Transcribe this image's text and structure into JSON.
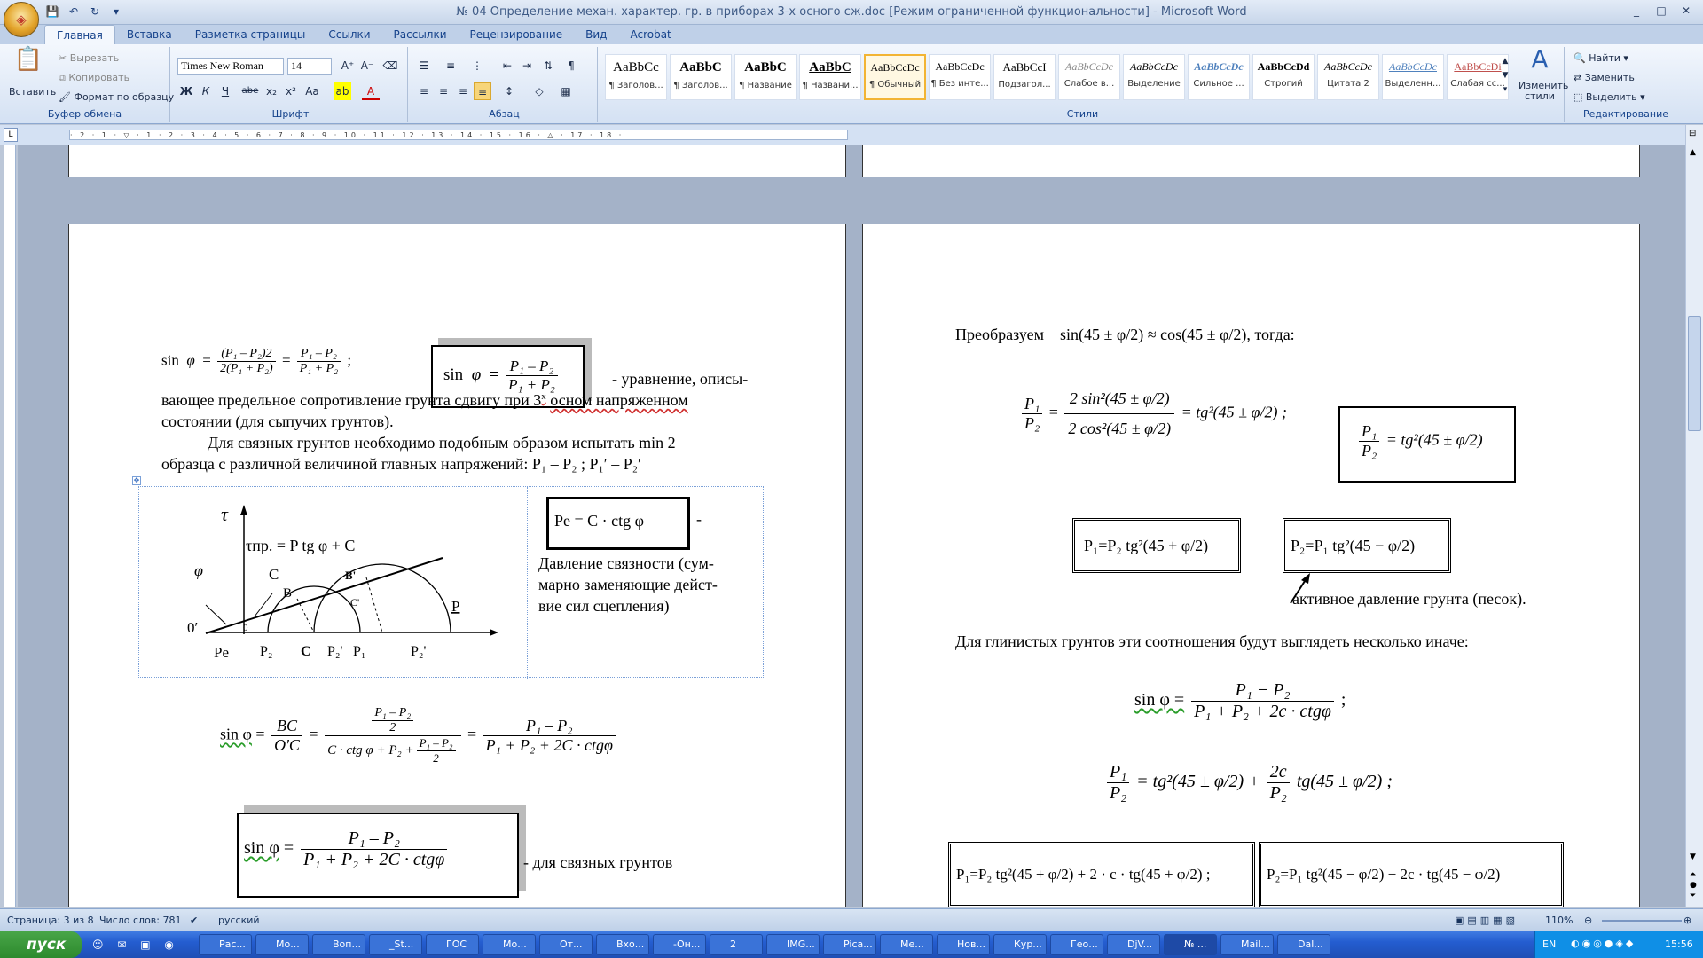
{
  "window": {
    "title": "№ 04 Определение механ. характер. гр. в приборах 3-х осного сж.doc [Режим ограниченной функциональности] - Microsoft Word",
    "controls": [
      "_",
      "□",
      "✕"
    ]
  },
  "tabs": [
    "Главная",
    "Вставка",
    "Разметка страницы",
    "Ссылки",
    "Рассылки",
    "Рецензирование",
    "Вид",
    "Acrobat"
  ],
  "ribbon": {
    "clipboard": {
      "paste": "Вставить",
      "cut": "Вырезать",
      "copy": "Копировать",
      "format": "Формат по образцу",
      "label": "Буфер обмена"
    },
    "font": {
      "name": "Times New Roman",
      "size": "14",
      "label": "Шрифт",
      "bold": "Ж",
      "italic": "К",
      "underline": "Ч",
      "strike": "abe",
      "sub": "x₂",
      "sup": "x²",
      "case": "Аа",
      "color": "А"
    },
    "paragraph": {
      "label": "Абзац"
    },
    "styles": {
      "label": "Стили",
      "items": [
        {
          "preview": "AaBbCc",
          "name": "¶ Заголов..."
        },
        {
          "preview": "AaBbC",
          "name": "¶ Заголов..."
        },
        {
          "preview": "AaBbC",
          "name": "¶ Название"
        },
        {
          "preview": "AaBbC",
          "name": "¶ Названи..."
        },
        {
          "preview": "AaBbCcDc",
          "name": "¶ Обычный"
        },
        {
          "preview": "AaBbCcDc",
          "name": "¶ Без инте..."
        },
        {
          "preview": "AaBbCcI",
          "name": "Подзагол..."
        },
        {
          "preview": "AaBbCcDc",
          "name": "Слабое в..."
        },
        {
          "preview": "AaBbCcDc",
          "name": "Выделение"
        },
        {
          "preview": "AaBbCcDc",
          "name": "Сильное ..."
        },
        {
          "preview": "AaBbCcDd",
          "name": "Строгий"
        },
        {
          "preview": "AaBbCcDc",
          "name": "Цитата 2"
        },
        {
          "preview": "AaBbCcDc",
          "name": "Выделенн..."
        },
        {
          "preview": "AaBbCcDi",
          "name": "Слабая сс..."
        }
      ],
      "change": "Изменить стили"
    },
    "editing": {
      "label": "Редактирование",
      "find": "Найти",
      "replace": "Заменить",
      "select": "Выделить"
    }
  },
  "ruler": {
    "marks": "· 2 · 1 · ▽ · 1 · 2 · 3 · 4 · 5 · 6 · 7 · 8 · 9 · 10 · 11 · 12 · 13 · 14 · 15 · 16 · △ · 17 · 18 ·"
  },
  "left_page": {
    "eq1_lhs": "sin",
    "eq1_phi": "φ",
    "eq1_num1": "(P₁ – P₂)2",
    "eq1_den1": "2(P₁ + P₂)",
    "eq1_num2": "P₁ – P₂",
    "eq1_den2": "P₁ + P₂",
    "box1_num": "P₁ – P₂",
    "box1_den": "P₁ + P₂",
    "line1_tail": "- уравнение, описы-",
    "line2": "вающее предельное сопротивление грунта сдвигу при 3",
    "line2_sup": "х",
    "line2_b": "осном напряженном",
    "line3": "состоянии (для сыпучих грунтов).",
    "line4": "Для связных грунтов необходимо подобным образом испытать  min 2",
    "line5": "образца с различной величиной главных напряжений: P₁ – P₂ ; P₁′ – P₂′",
    "diagram": {
      "tau": "τ",
      "tau_pr": "τпр. = P tg  φ + C",
      "phi": "φ",
      "C_top": "C",
      "B": "B",
      "B2": "B'",
      "C_mid": "C'",
      "P": "P",
      "O": "0′",
      "Pe": "Pe",
      "P2": "P₂",
      "Cb": "C",
      "P2p": "P₂'",
      "P1": "P₁",
      "P2pp": "P₂'",
      "o": "0"
    },
    "pe_formula": "Pe = C · ctg φ",
    "pe_dash": "-",
    "pressure_text": [
      "Давление связности (сум-",
      "марно заменяющие дейст-",
      "вие сил сцепления)"
    ],
    "eq2": {
      "lhs": "sin φ",
      "f1num": "BC",
      "f1den": "O'C",
      "innum": "P₁ – P₂",
      "inden": "2",
      "den_a": "C · ctg φ + P₂ +",
      "den_bn": "P₁ – P₂",
      "den_bd": "2",
      "rnum": "P₁ – P₂",
      "rden": "P₁ + P₂ + 2C · ctgφ"
    },
    "box2": {
      "lhs": "sin φ",
      "num": "P₁ – P₂",
      "den": "P₁ + P₂ + 2C · ctgφ"
    },
    "box2_tail": "- для связных грунтов"
  },
  "right_page": {
    "line1_a": "Преобразуем",
    "line1_b": "sin(45 ± φ/2) ≈ cos(45 ± φ/2)",
    "line1_c": ", тогда:",
    "eq_ratio": {
      "lnum": "P₁",
      "lden": "P₂",
      "num": "2 sin²(45 ± φ/2)",
      "den": "2 cos²(45 ± φ/2)",
      "rhs": "= tg²(45 ± φ/2) ;"
    },
    "box_ratio": "= tg²(45 ± φ/2)",
    "box_p1": "P₁=P₂ tg²(45 + φ/2)",
    "box_p2": "P₂=P₁ tg²(45 − φ/2)",
    "active_text": "активное давление грунта (песок).",
    "clay_text": "Для глинистых грунтов эти соотношения будут выглядеть несколько иначе:",
    "eq_sin": {
      "lhs": "sin φ =",
      "num": "P₁ − P₂",
      "den": "P₁ + P₂ + 2c · ctgφ",
      "tail": ";"
    },
    "eq_ratio2": {
      "lnum": "P₁",
      "lden": "P₂",
      "mid": "= tg²(45 ± φ/2) +",
      "cnum": "2c",
      "cden": "P₂",
      "tail": "tg(45 ± φ/2) ;"
    },
    "box_bottom1": "P₁=P₂ tg²(45 + φ/2) + 2 · c · tg(45 + φ/2) ;",
    "box_bottom2": "P₂=P₁ tg²(45 − φ/2) − 2c · tg(45 − φ/2)"
  },
  "status": {
    "page": "Страница: 3 из 8",
    "words": "Число слов: 781",
    "lang": "русский",
    "zoom": "110%"
  },
  "taskbar": {
    "start": "пуск",
    "items": [
      "Рас...",
      "Мо...",
      "Воп...",
      "_St...",
      "ГОС",
      "Мо...",
      "От...",
      "Вхо...",
      "-Он...",
      "2",
      "IMG...",
      "Pica...",
      "Ме...",
      "Нов...",
      "Кур...",
      "Гео...",
      "DjV...",
      "№ ...",
      "Mail...",
      "Dal..."
    ],
    "lang": "EN",
    "time": "15:56"
  }
}
